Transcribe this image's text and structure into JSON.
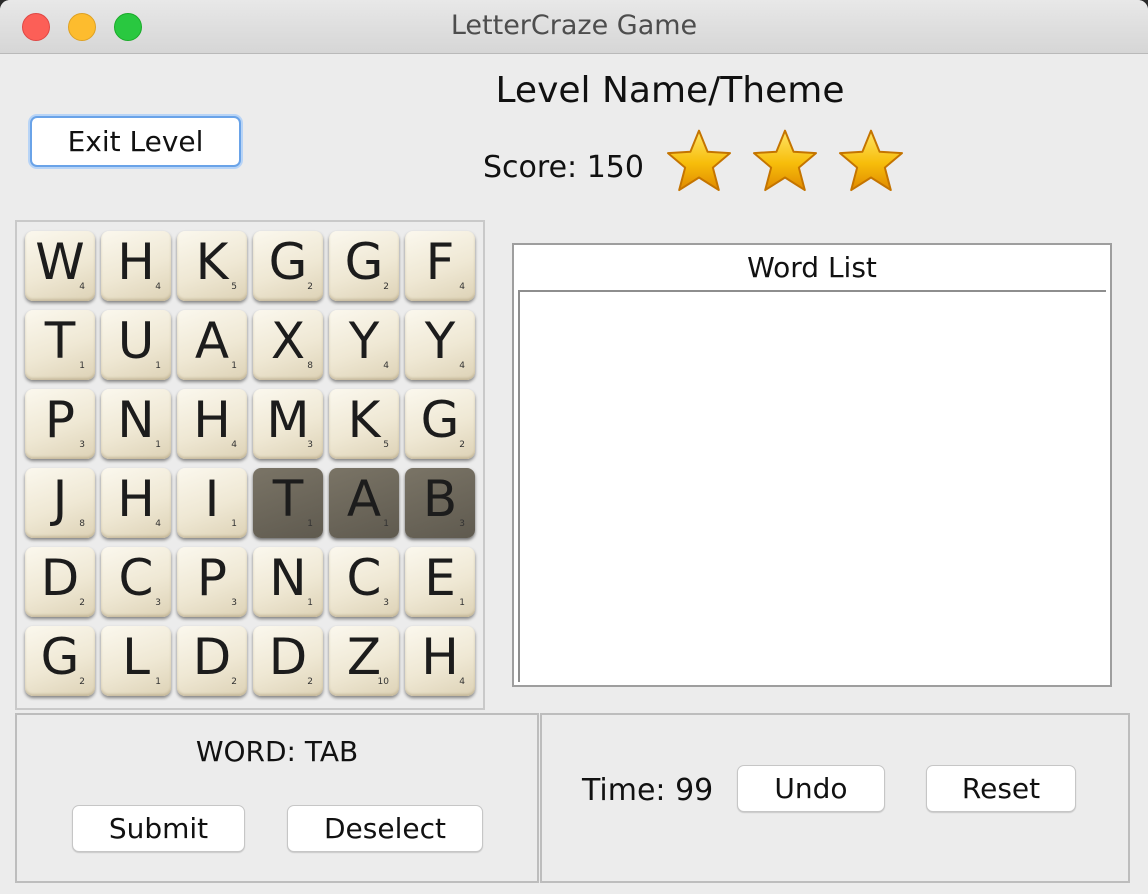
{
  "window": {
    "title": "LetterCraze Game"
  },
  "header": {
    "level_name": "Level Name/Theme",
    "exit_label": "Exit Level",
    "score_label": "Score:",
    "score_value": "150",
    "stars_earned": 3,
    "stars_total": 3,
    "star_color": "#f5b800"
  },
  "board": {
    "rows": [
      [
        {
          "l": "W",
          "p": "4"
        },
        {
          "l": "H",
          "p": "4"
        },
        {
          "l": "K",
          "p": "5"
        },
        {
          "l": "G",
          "p": "2"
        },
        {
          "l": "G",
          "p": "2"
        },
        {
          "l": "F",
          "p": "4"
        }
      ],
      [
        {
          "l": "T",
          "p": "1"
        },
        {
          "l": "U",
          "p": "1"
        },
        {
          "l": "A",
          "p": "1"
        },
        {
          "l": "X",
          "p": "8"
        },
        {
          "l": "Y",
          "p": "4"
        },
        {
          "l": "Y",
          "p": "4"
        }
      ],
      [
        {
          "l": "P",
          "p": "3"
        },
        {
          "l": "N",
          "p": "1"
        },
        {
          "l": "H",
          "p": "4"
        },
        {
          "l": "M",
          "p": "3"
        },
        {
          "l": "K",
          "p": "5"
        },
        {
          "l": "G",
          "p": "2"
        }
      ],
      [
        {
          "l": "J",
          "p": "8"
        },
        {
          "l": "H",
          "p": "4"
        },
        {
          "l": "I",
          "p": "1"
        },
        {
          "l": "T",
          "p": "1",
          "sel": true
        },
        {
          "l": "A",
          "p": "1",
          "sel": true
        },
        {
          "l": "B",
          "p": "3",
          "sel": true
        }
      ],
      [
        {
          "l": "D",
          "p": "2"
        },
        {
          "l": "C",
          "p": "3"
        },
        {
          "l": "P",
          "p": "3"
        },
        {
          "l": "N",
          "p": "1"
        },
        {
          "l": "C",
          "p": "3"
        },
        {
          "l": "E",
          "p": "1"
        }
      ],
      [
        {
          "l": "G",
          "p": "2"
        },
        {
          "l": "L",
          "p": "1"
        },
        {
          "l": "D",
          "p": "2"
        },
        {
          "l": "D",
          "p": "2"
        },
        {
          "l": "Z",
          "p": "10"
        },
        {
          "l": "H",
          "p": "4"
        }
      ]
    ]
  },
  "word_list": {
    "header": "Word List",
    "items": []
  },
  "word_panel": {
    "word_label": "WORD: TAB",
    "submit_label": "Submit",
    "deselect_label": "Deselect"
  },
  "control_panel": {
    "time_label": "Time:",
    "time_value": "99",
    "undo_label": "Undo",
    "reset_label": "Reset"
  }
}
